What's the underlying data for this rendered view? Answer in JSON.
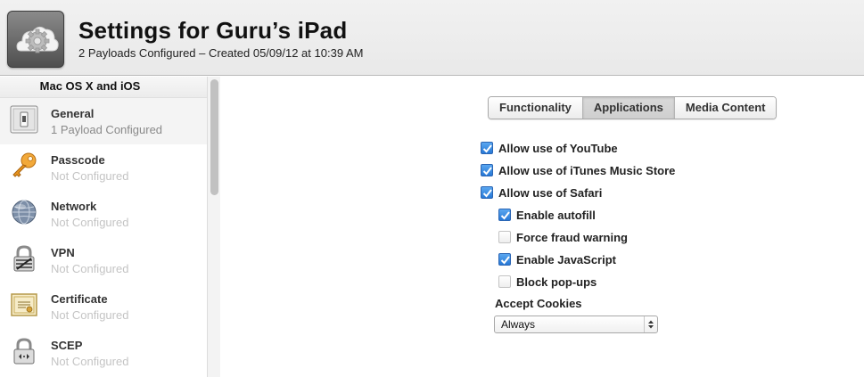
{
  "header": {
    "title": "Settings for Guru’s iPad",
    "subtitle": "2 Payloads Configured – Created 05/09/12 at 10:39 AM",
    "icon": "settings-gear-icon"
  },
  "sidebar": {
    "header": "Mac OS X and iOS",
    "items": [
      {
        "title": "General",
        "subtitle": "1 Payload Configured",
        "icon": "switch-icon"
      },
      {
        "title": "Passcode",
        "subtitle": "Not Configured",
        "icon": "key-icon"
      },
      {
        "title": "Network",
        "subtitle": "Not Configured",
        "icon": "globe-icon"
      },
      {
        "title": "VPN",
        "subtitle": "Not Configured",
        "icon": "lock-icon"
      },
      {
        "title": "Certificate",
        "subtitle": "Not Configured",
        "icon": "certificate-icon"
      },
      {
        "title": "SCEP",
        "subtitle": "Not Configured",
        "icon": "scep-lock-icon"
      }
    ]
  },
  "tabs": [
    {
      "label": "Functionality",
      "active": false
    },
    {
      "label": "Applications",
      "active": true
    },
    {
      "label": "Media Content",
      "active": false
    }
  ],
  "options": [
    {
      "label": "Allow use of YouTube",
      "checked": true
    },
    {
      "label": "Allow use of iTunes Music Store",
      "checked": true
    },
    {
      "label": "Allow use of Safari",
      "checked": true
    },
    {
      "label": "Enable autofill",
      "checked": true
    },
    {
      "label": "Force fraud warning",
      "checked": false
    },
    {
      "label": "Enable JavaScript",
      "checked": true
    },
    {
      "label": "Block pop-ups",
      "checked": false
    }
  ],
  "cookies": {
    "label": "Accept Cookies",
    "value": "Always"
  },
  "colors": {
    "checkbox_on": "#2778d6",
    "header_bg": "#ececec"
  }
}
